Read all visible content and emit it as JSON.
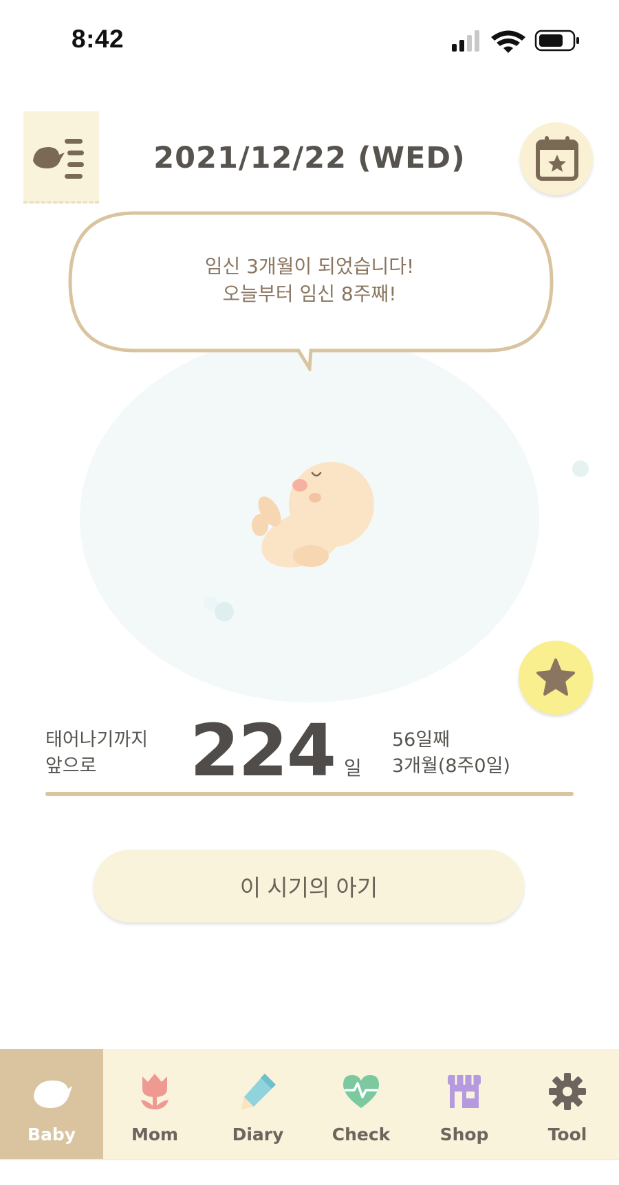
{
  "status_bar": {
    "time": "8:42"
  },
  "header": {
    "date": "2021/12/22 (WED)",
    "menu_icon": "bird-list-icon",
    "calendar_icon": "calendar-star-icon"
  },
  "message": {
    "line1": "임신 3개월이 되었습니다!",
    "line2": "오늘부터 임신 8주째!"
  },
  "countdown": {
    "label_line1": "태어나기까지",
    "label_line2": "앞으로",
    "days_left": "224",
    "unit": "일",
    "day_count": "56일째",
    "month_info": "3개월(8주0일)"
  },
  "info_button": {
    "label": "이 시기의 아기"
  },
  "tabs": [
    {
      "label": "Baby",
      "icon": "bird-icon",
      "active": true
    },
    {
      "label": "Mom",
      "icon": "tulip-icon",
      "active": false
    },
    {
      "label": "Diary",
      "icon": "pencil-icon",
      "active": false
    },
    {
      "label": "Check",
      "icon": "heart-pulse-icon",
      "active": false
    },
    {
      "label": "Shop",
      "icon": "store-icon",
      "active": false
    },
    {
      "label": "Tool",
      "icon": "gear-icon",
      "active": false
    }
  ],
  "colors": {
    "accent_tan": "#d9c49f",
    "cream": "#faf3dc",
    "star_yellow": "#f9ef8e",
    "text_brown": "#8a7560"
  }
}
